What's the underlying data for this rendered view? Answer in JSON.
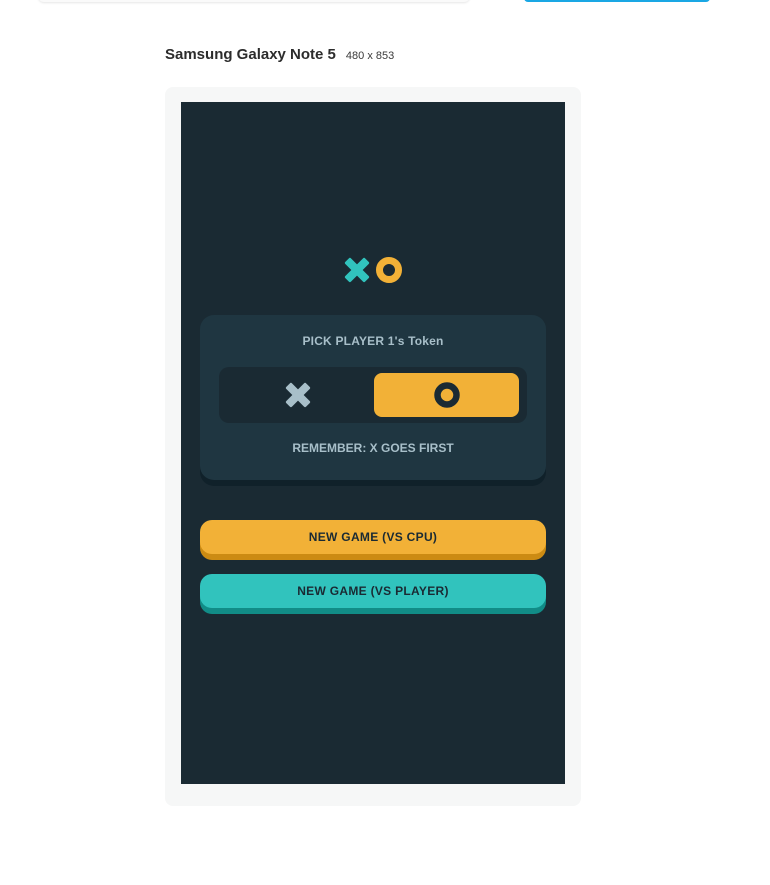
{
  "device": {
    "name": "Samsung Galaxy Note 5",
    "resolution": "480 x 853"
  },
  "app": {
    "logo": {
      "x_icon": "x-mark-icon",
      "o_icon": "o-mark-icon"
    },
    "pick_title": "PICK PLAYER 1's Token",
    "token_options": [
      {
        "token": "X",
        "icon": "x-mark-icon",
        "selected": false
      },
      {
        "token": "O",
        "icon": "o-mark-icon",
        "selected": true
      }
    ],
    "reminder": "REMEMBER: X GOES FIRST",
    "buttons": {
      "vs_cpu": "NEW GAME (VS CPU)",
      "vs_player": "NEW GAME (VS PLAYER)"
    }
  },
  "colors": {
    "background": "#1a2a33",
    "card": "#1f3641",
    "silver": "#a8bfc9",
    "yellow": "#f2b137",
    "teal": "#31c3bd",
    "accent_blue": "#1aa7e4"
  }
}
